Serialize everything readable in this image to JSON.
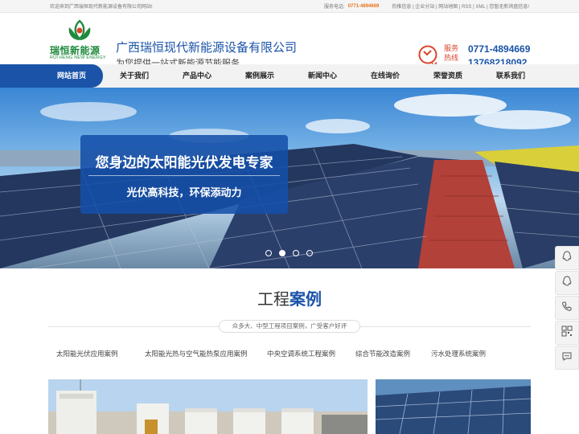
{
  "topbar": {
    "welcome": "欢迎来到广西瑞恒现代新能源设备有限公司网站!",
    "service_label": "服务电话:",
    "service_phone": "0771-4894669",
    "links": "热推信息 | 企业分站 | 网站地图 | RSS | XML | 您暂无新询盘信息!"
  },
  "logo": {
    "text": "瑞恒新能源",
    "sub": "RUI HENG NEW ENERGY"
  },
  "header": {
    "company_name": "广西瑞恒现代新能源设备有限公司",
    "slogan": "为您提供一站式新能源节能服务",
    "hotline_label": "服务热线",
    "phone1": "0771-4894669",
    "phone2": "13768218092",
    "hotline_icon_text": "24"
  },
  "nav": {
    "items": [
      {
        "label": "网站首页",
        "active": true
      },
      {
        "label": "关于我们",
        "active": false
      },
      {
        "label": "产品中心",
        "active": false
      },
      {
        "label": "案例展示",
        "active": false
      },
      {
        "label": "新闻中心",
        "active": false
      },
      {
        "label": "在线询价",
        "active": false
      },
      {
        "label": "荣誉资质",
        "active": false
      },
      {
        "label": "联系我们",
        "active": false
      }
    ]
  },
  "banner": {
    "title": "您身边的太阳能光伏发电专家",
    "subtitle": "光伏高科技，环保添动力",
    "slide_count": 4,
    "active_slide": 2
  },
  "section": {
    "title_part1": "工程",
    "title_part2": "案例",
    "subtitle": "众多大、中型工程项目案例，广受客户好评",
    "tabs": [
      "太阳能光伏应用案例",
      "太阳能光热与空气能热泵应用案例",
      "中央空调系统工程案例",
      "综合节能改造案例",
      "污水处理系统案例"
    ]
  },
  "sidebar": {
    "icons": [
      "qq-icon",
      "qq-icon",
      "phone-icon",
      "qrcode-icon",
      "chat-icon"
    ]
  },
  "colors": {
    "brand_blue": "#1a53a8",
    "brand_green": "#1e8a3c",
    "accent_orange": "#e8731a",
    "hotline_red": "#d9452b"
  }
}
